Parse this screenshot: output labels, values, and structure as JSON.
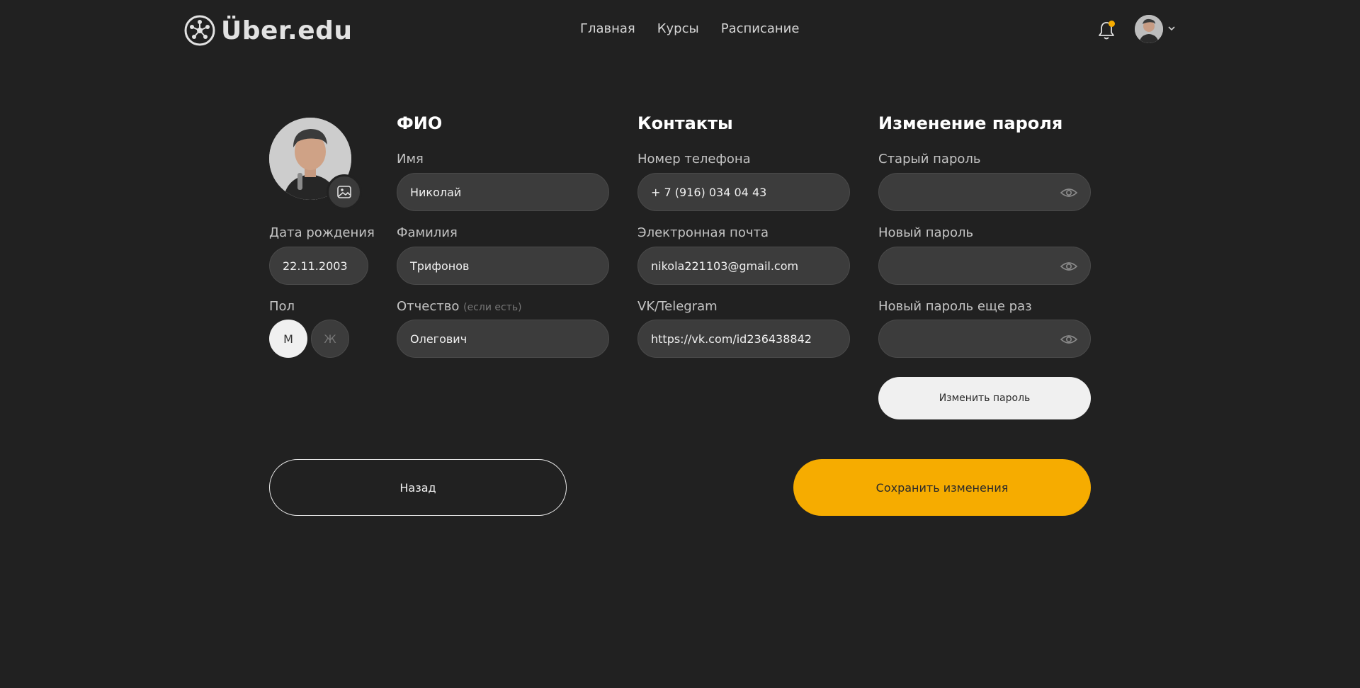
{
  "header": {
    "logo_text": "Über.edu",
    "nav": [
      "Главная",
      "Курсы",
      "Расписание"
    ],
    "accent_color": "#f6ac00"
  },
  "profile": {
    "birth_label": "Дата рождения",
    "birth_value": "22.11.2003",
    "gender_label": "Пол",
    "gender_male": "М",
    "gender_female": "Ж",
    "gender_selected": "М"
  },
  "fio": {
    "title": "ФИО",
    "first_label": "Имя",
    "first_value": "Николай",
    "last_label": "Фамилия",
    "last_value": "Трифонов",
    "middle_label": "Отчество",
    "middle_hint": "(если есть)",
    "middle_value": "Олегович"
  },
  "contacts": {
    "title": "Контакты",
    "phone_label": "Номер телефона",
    "phone_value": "+ 7 (916) 034 04 43",
    "email_label": "Электронная почта",
    "email_value": "nikola221103@gmail.com",
    "social_label": "VK/Telegram",
    "social_value": "https://vk.com/id236438842"
  },
  "password": {
    "title": "Изменение пароля",
    "old_label": "Старый пароль",
    "new_label": "Новый пароль",
    "repeat_label": "Новый пароль еще раз",
    "change_button": "Изменить пароль"
  },
  "actions": {
    "back": "Назад",
    "save": "Сохранить изменения"
  }
}
